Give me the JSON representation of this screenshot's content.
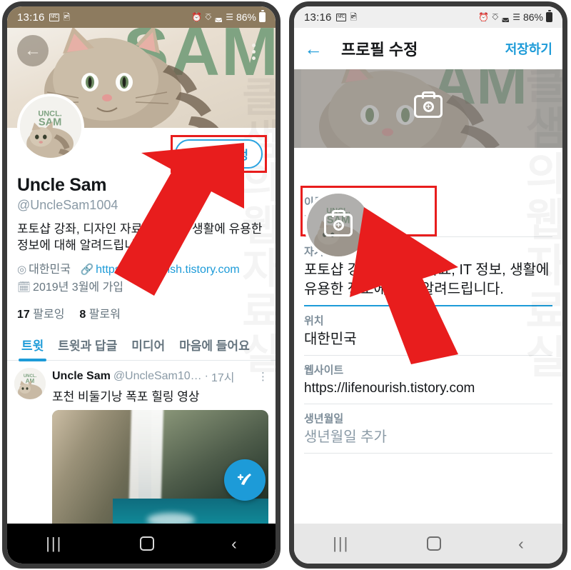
{
  "status_bar": {
    "time": "13:16",
    "battery": "86%",
    "icons": [
      "nfc-icon",
      "image-icon",
      "alarm-icon",
      "bluetooth-icon",
      "wifi-icon",
      "signal-icon",
      "battery-icon"
    ]
  },
  "left_phone": {
    "banner_word": "SAM",
    "back_icon": "back-arrow-icon",
    "overflow_icon": "more-vertical-icon",
    "edit_profile_button": "프로필 수정",
    "display_name": "Uncle Sam",
    "handle": "@UncleSam1004",
    "bio": "포토샵 강좌, 디자인 자료, IT 정보, 생활에 유용한 정보에 대해 알려드립니다.",
    "location": "대한민국",
    "website": "https://lifenourish.tistory.com",
    "joined": "2019년 3월에 가입",
    "following_count": "17",
    "following_label": "팔로잉",
    "followers_count": "8",
    "followers_label": "팔로워",
    "tabs": [
      "트윗",
      "트윗과 답글",
      "미디어",
      "마음에 들어요"
    ],
    "active_tab_index": 0,
    "tweet": {
      "author": "Uncle Sam",
      "handle": "@UncleSam10…",
      "time": "17시",
      "separator": "·",
      "text": "포천 비둘기낭 폭포 힐링 영상",
      "overflow_icon": "more-vertical-icon"
    },
    "compose_fab": "compose-tweet-icon",
    "nav": [
      "recents-icon",
      "home-icon",
      "back-icon"
    ]
  },
  "right_phone": {
    "appbar": {
      "back_icon": "back-arrow-icon",
      "title": "프로필 수정",
      "save_label": "저장하기"
    },
    "banner_camera_icon": "camera-add-icon",
    "avatar_camera_icon": "camera-add-icon",
    "fields": [
      {
        "label": "이름",
        "value": "Uncle Sam",
        "placeholder": false,
        "accent": false,
        "highlight": true
      },
      {
        "label": "자기소개",
        "value": "포토샵 강좌, 디자인 자료, IT 정보, 생활에 유용한 정보에 대해 알려드립니다.",
        "placeholder": false,
        "accent": true,
        "highlight": false
      },
      {
        "label": "위치",
        "value": "대한민국",
        "placeholder": false,
        "accent": false,
        "highlight": false
      },
      {
        "label": "웹사이트",
        "value": "https://lifenourish.tistory.com",
        "placeholder": false,
        "accent": false,
        "highlight": false
      },
      {
        "label": "생년월일",
        "value": "생년월일 추가",
        "placeholder": true,
        "accent": false,
        "highlight": false
      }
    ],
    "nav": [
      "recents-icon",
      "home-icon",
      "back-icon"
    ]
  },
  "watermark": {
    "left": "클샘의웹자료실",
    "right": "클샘의웹자료실"
  },
  "annotations": {
    "arrow_color": "#e81d1d",
    "highlight_color": "#e81d1d",
    "arrow_left_target": "프로필 수정",
    "arrow_right_target": "이름"
  },
  "colors": {
    "accent": "#1d9bd8",
    "annotation": "#e81d1d",
    "banner_green": "#7fa382",
    "muted_text": "#66757f"
  }
}
